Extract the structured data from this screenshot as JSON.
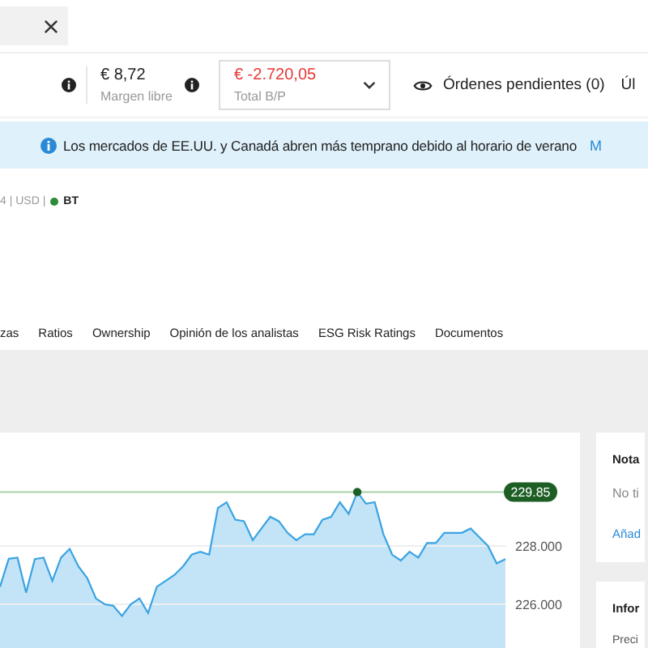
{
  "search": {
    "has_clear": true
  },
  "metrics": [
    {
      "kind": "info",
      "value": "€ 8,72",
      "label": "Margen libre"
    },
    {
      "kind": "dropdown",
      "value": "€ -2.720,05",
      "label": "Total B/P",
      "negative": true
    }
  ],
  "orders": {
    "label": "Órdenes pendientes (0)",
    "next": "Úl"
  },
  "banner": {
    "text": "Los mercados de EE.UU. y Canadá abren más temprano debido al horario de verano",
    "link": "M"
  },
  "instrument": {
    "meta": "4 | USD |",
    "status": {
      "label": "BT",
      "color": "#2e8b3a"
    }
  },
  "tabs": [
    {
      "label": "zas",
      "selected": false
    },
    {
      "label": "Ratios",
      "selected": false
    },
    {
      "label": "Ownership",
      "selected": false
    },
    {
      "label": "Opinión de los analistas",
      "selected": false
    },
    {
      "label": "ESG Risk Ratings",
      "selected": false
    },
    {
      "label": "Documentos",
      "selected": false
    }
  ],
  "chart": {
    "axis_labels": [
      "228.000",
      "226.000"
    ],
    "price_badge": "229.85"
  },
  "notes": {
    "title": "Nota",
    "text": "No ti",
    "link": "Añad"
  },
  "info": {
    "title": "Infor",
    "row": "Preci"
  }
}
